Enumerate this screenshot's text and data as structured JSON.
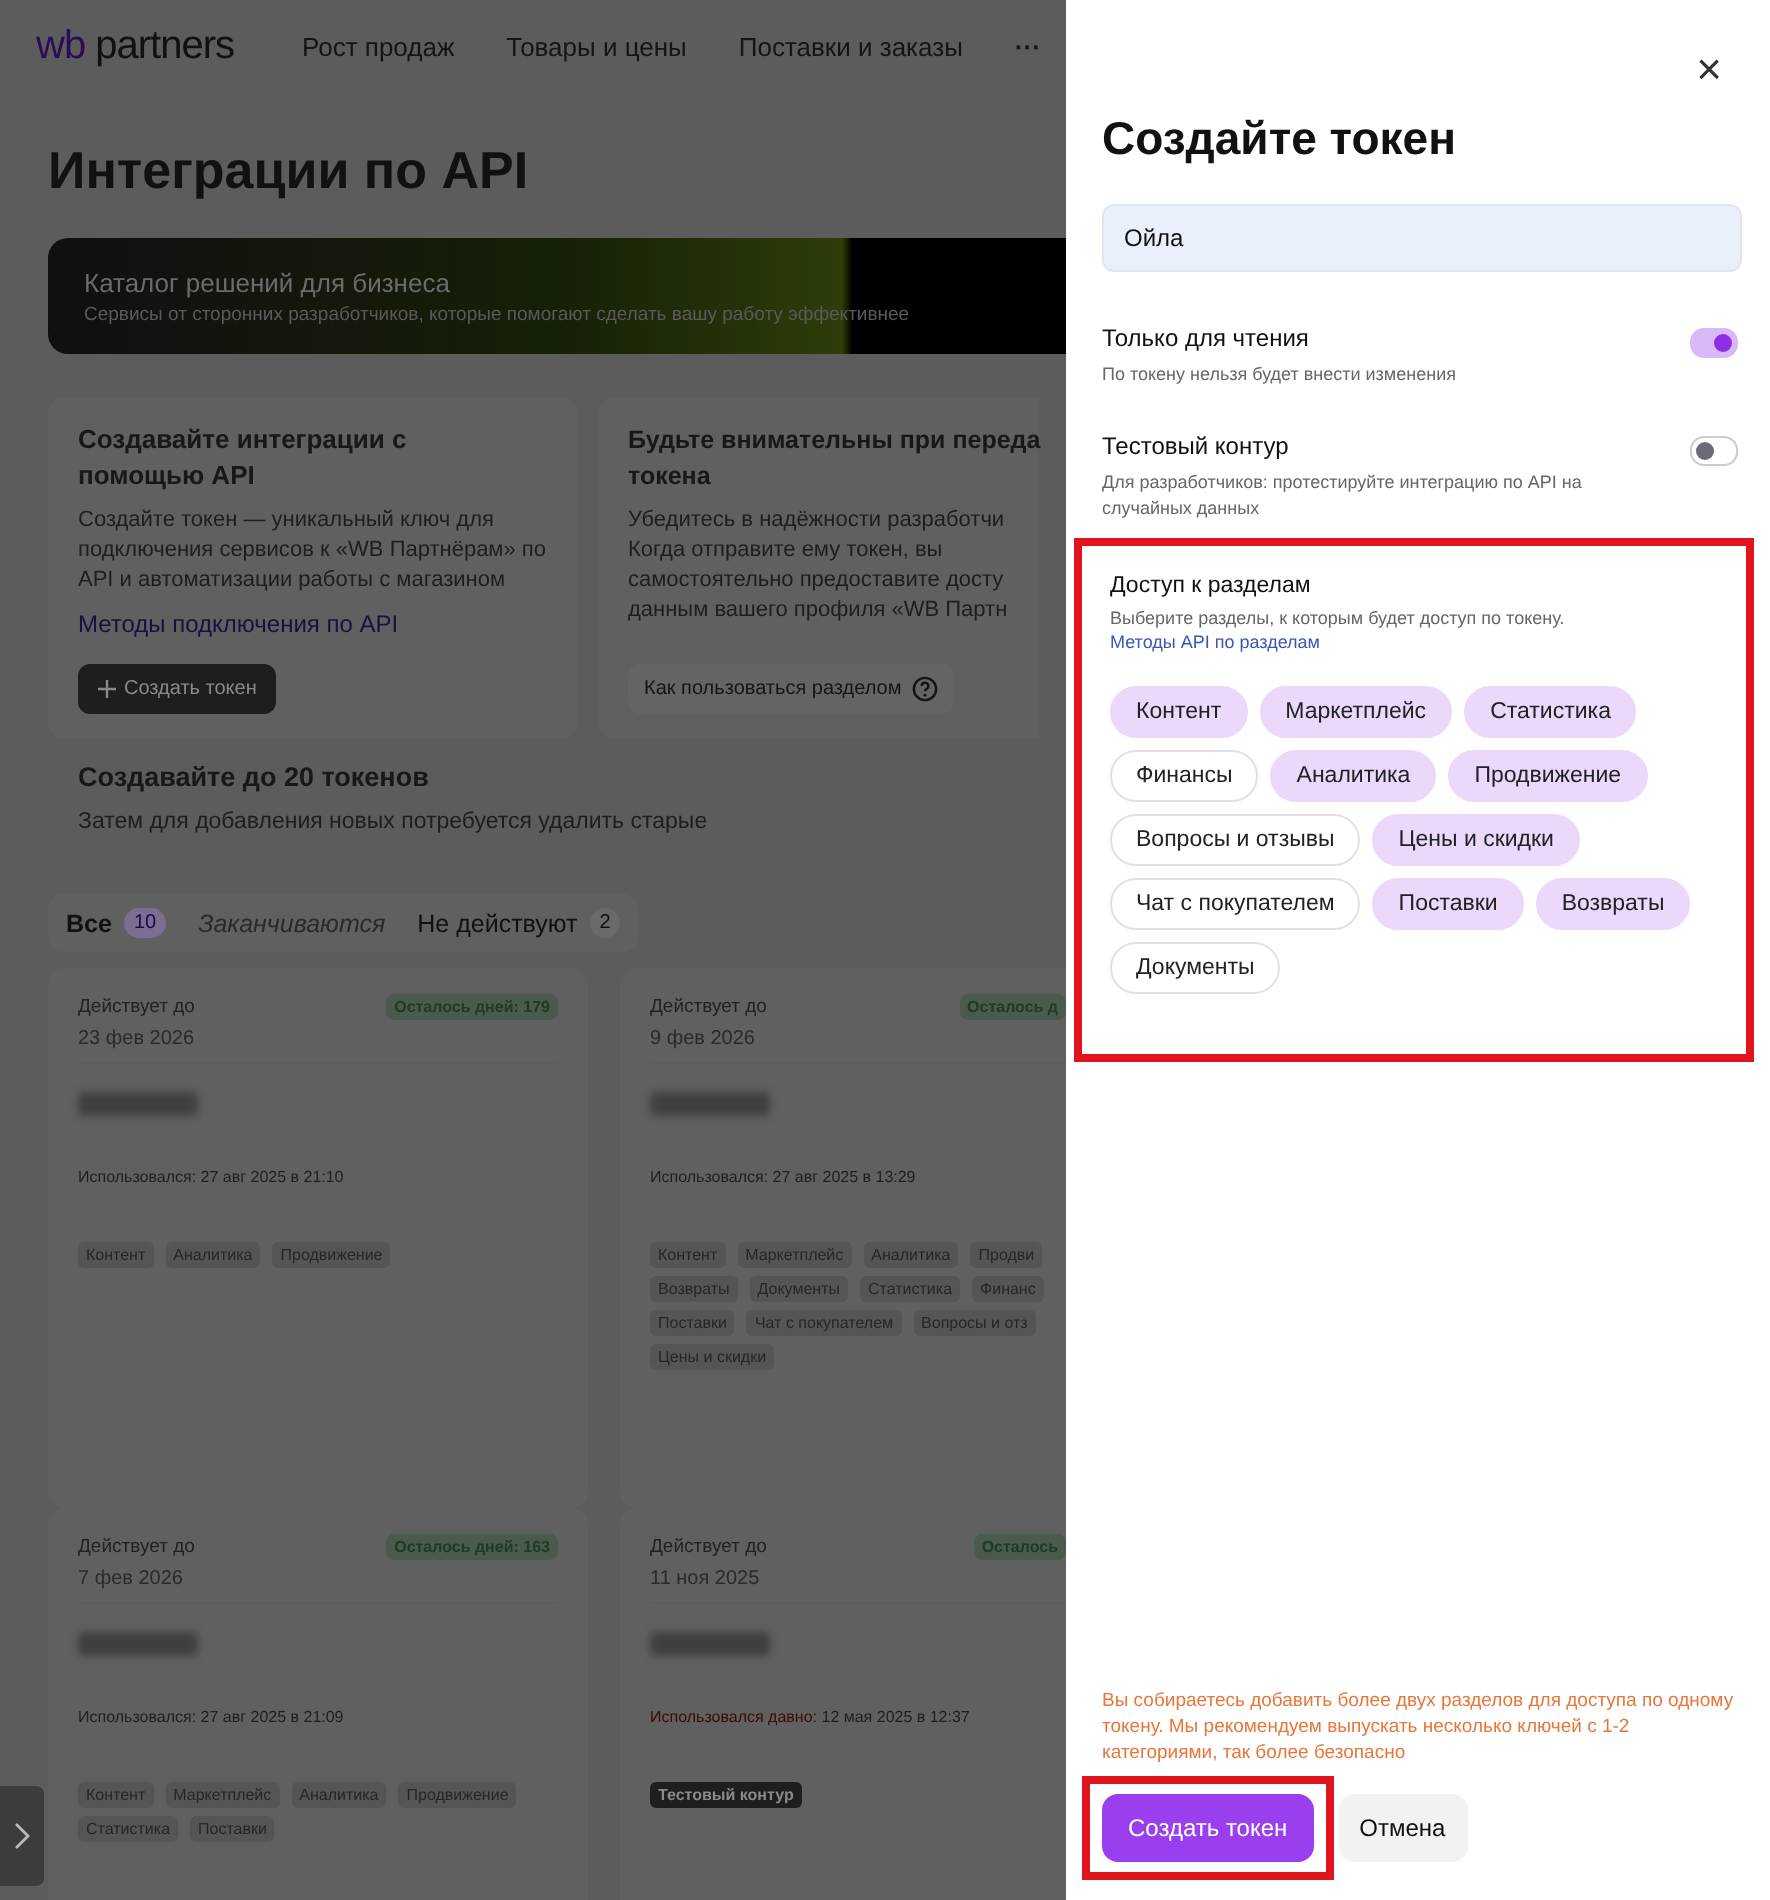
{
  "header": {
    "logo_mark": "wb",
    "logo_text": "partners",
    "nav": [
      "Рост продаж",
      "Товары и цены",
      "Поставки и заказы"
    ],
    "more": "···"
  },
  "page": {
    "title": "Интеграции по API",
    "banner": {
      "title": "Каталог решений для бизнеса",
      "subtitle": "Сервисы от сторонних разработчиков, которые помогают сделать вашу работу эффективнее"
    },
    "info": [
      {
        "title": "Создавайте интеграции с помощью API",
        "text": "Создайте токен — уникальный ключ для подключения сервисов к «WB Партнёрам» по API и автоматизации работы с магазином",
        "link": "Методы подключения по API",
        "button": "Создать токен",
        "kind": "primary"
      },
      {
        "title": "Будьте внимательны при переда токена",
        "text": "Убедитесь в надёжности разработчи Когда отправите ему токен, вы самостоятельно предоставите досту данным вашего профиля «WB Партн",
        "button": "Как пользоваться разделом",
        "kind": "help"
      }
    ],
    "limit": {
      "title": "Создавайте до 20 токенов",
      "text": "Затем для добавления новых потребуется удалить старые"
    },
    "tabs": [
      {
        "label": "Все",
        "count": "10",
        "selected": true,
        "disabled": false
      },
      {
        "label": "Заканчиваются",
        "selected": false,
        "disabled": true
      },
      {
        "label": "Не действуют",
        "count": "2",
        "selected": false,
        "disabled": false
      }
    ],
    "tokens": [
      {
        "valid_label": "Действует до",
        "date": "23 фев 2026",
        "days": "Осталось дней: 179",
        "used_label": "Использовался:",
        "used": "27 авг 2025 в 21:10",
        "stale": false,
        "tags": [
          {
            "label": "Контент",
            "kind": "section"
          },
          {
            "label": "Аналитика",
            "kind": "section"
          },
          {
            "label": "Продвижение",
            "kind": "section"
          }
        ]
      },
      {
        "valid_label": "Действует до",
        "date": "9 фев 2026",
        "days": "Осталось д",
        "used_label": "Использовался:",
        "used": "27 авг 2025 в 13:29",
        "stale": false,
        "tags": [
          {
            "label": "Контент",
            "kind": "section"
          },
          {
            "label": "Маркетплейс",
            "kind": "section"
          },
          {
            "label": "Аналитика",
            "kind": "section"
          },
          {
            "label": "Продви",
            "kind": "section"
          },
          {
            "label": "Возвраты",
            "kind": "section"
          },
          {
            "label": "Документы",
            "kind": "section"
          },
          {
            "label": "Статистика",
            "kind": "section"
          },
          {
            "label": "Финанс",
            "kind": "section"
          },
          {
            "label": "Поставки",
            "kind": "section"
          },
          {
            "label": "Чат с покупателем",
            "kind": "section"
          },
          {
            "label": "Вопросы и отз",
            "kind": "section"
          },
          {
            "label": "Цены и скидки",
            "kind": "section"
          }
        ]
      },
      {
        "valid_label": "Действует до",
        "date": "7 фев 2026",
        "days": "Осталось дней: 163",
        "used_label": "Использовался:",
        "used": "27 авг 2025 в 21:09",
        "stale": false,
        "tags": [
          {
            "label": "Контент",
            "kind": "section"
          },
          {
            "label": "Маркетплейс",
            "kind": "section"
          },
          {
            "label": "Аналитика",
            "kind": "section"
          },
          {
            "label": "Продвижение",
            "kind": "section"
          },
          {
            "label": "Статистика",
            "kind": "section"
          },
          {
            "label": "Поставки",
            "kind": "section"
          }
        ]
      },
      {
        "valid_label": "Действует до",
        "date": "11 ноя 2025",
        "days": "Осталось",
        "used_label": "Использовался давно:",
        "used": "12 мая 2025 в 12:37",
        "stale": true,
        "tags": [
          {
            "label": "Тестовый контур",
            "kind": "test"
          }
        ]
      }
    ]
  },
  "panel": {
    "close": "×",
    "title": "Создайте токен",
    "name_value": "Ойла",
    "toggles": [
      {
        "label": "Только для чтения",
        "hint": "По токену нельзя будет внести изменения",
        "on": true
      },
      {
        "label": "Тестовый контур",
        "hint": "Для разработчиков: протестируйте интеграцию по API на случайных данных",
        "on": false
      }
    ],
    "access": {
      "title": "Доступ к разделам",
      "hint": "Выберите разделы, к которым будет доступ по токену.",
      "link": "Методы API по разделам",
      "highlighted": true,
      "sections": [
        {
          "label": "Контент",
          "selected": true
        },
        {
          "label": "Маркетплейс",
          "selected": true
        },
        {
          "label": "Статистика",
          "selected": true
        },
        {
          "label": "Финансы",
          "selected": false
        },
        {
          "label": "Аналитика",
          "selected": true
        },
        {
          "label": "Продвижение",
          "selected": true
        },
        {
          "label": "Вопросы и отзывы",
          "selected": false
        },
        {
          "label": "Цены и скидки",
          "selected": true
        },
        {
          "label": "Чат с покупателем",
          "selected": false
        },
        {
          "label": "Поставки",
          "selected": true
        },
        {
          "label": "Возвраты",
          "selected": true
        },
        {
          "label": "Документы",
          "selected": false
        }
      ]
    },
    "warning": "Вы собираетесь добавить более двух разделов для доступа по одному токену. Мы рекомендуем выпускать несколько ключей с 1-2 категориями, так более безопасно",
    "submit": {
      "label": "Создать токен",
      "highlighted": true
    },
    "cancel": "Отмена"
  }
}
